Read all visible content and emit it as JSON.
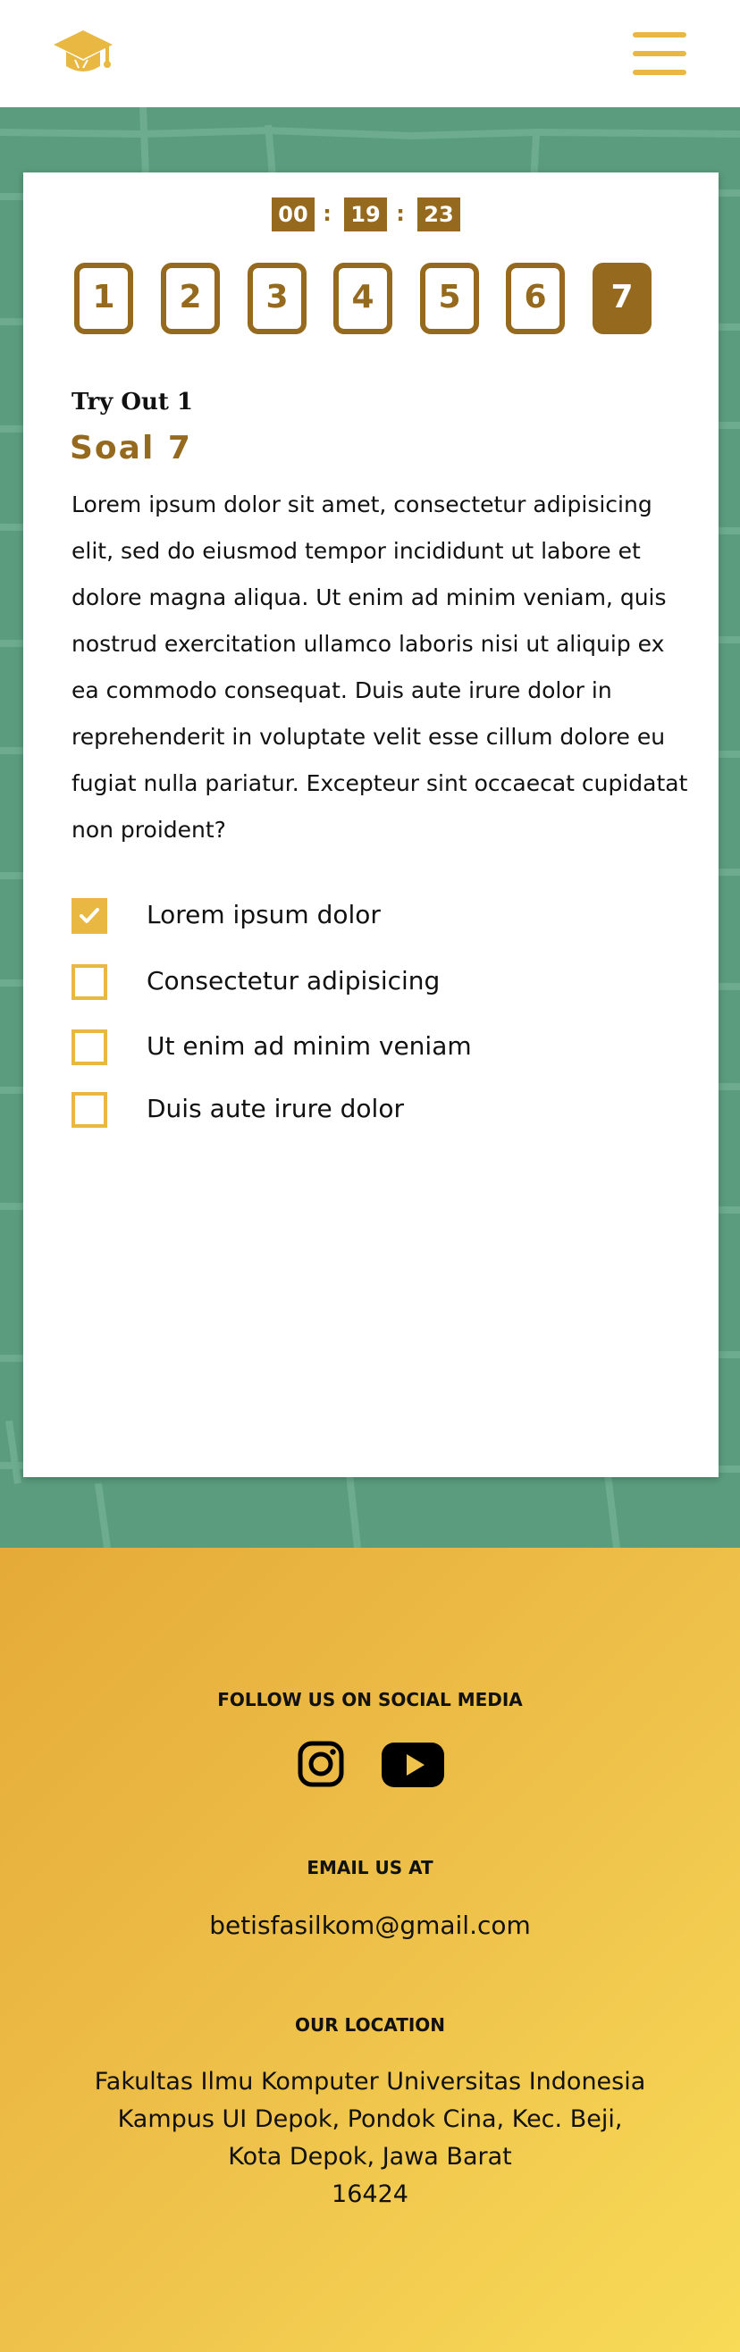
{
  "header": {
    "logo_icon": "graduation-cap-icon",
    "menu_icon": "hamburger-menu-icon",
    "accent_color": "#E8B843"
  },
  "timer": {
    "hours": "00",
    "minutes": "19",
    "seconds": "23",
    "separator": ":"
  },
  "question_nav": [
    {
      "label": "1",
      "active": false
    },
    {
      "label": "2",
      "active": false
    },
    {
      "label": "3",
      "active": false
    },
    {
      "label": "4",
      "active": false
    },
    {
      "label": "5",
      "active": false
    },
    {
      "label": "6",
      "active": false
    },
    {
      "label": "7",
      "active": true
    }
  ],
  "quiz": {
    "tryout_label": "Try Out 1",
    "question_title": "Soal 7",
    "question_text": "Lorem ipsum dolor sit amet, consectetur adipisicing elit, sed do eiusmod  tempor incididunt ut labore et dolore magna aliqua. Ut enim ad minim veniam, quis nostrud exercitation ullamco laboris nisi ut aliquip ex ea commodo consequat. Duis aute irure dolor in reprehenderit in voluptate velit esse cillum dolore eu fugiat nulla pariatur. Excepteur sint occaecat cupidatat non proident?",
    "options": [
      {
        "label": "Lorem ipsum dolor",
        "checked": true
      },
      {
        "label": "Consectetur adipisicing",
        "checked": false
      },
      {
        "label": "Ut enim ad minim veniam",
        "checked": false
      },
      {
        "label": "Duis aute irure dolor",
        "checked": false
      }
    ]
  },
  "footer": {
    "social_heading": "FOLLOW US ON SOCIAL MEDIA",
    "social_icons": [
      "instagram-icon",
      "youtube-icon"
    ],
    "email_heading": "EMAIL US AT",
    "email": "betisfasilkom@gmail.com",
    "location_heading": "OUR LOCATION",
    "location_lines": [
      "Fakultas Ilmu Komputer Universitas Indonesia",
      "Kampus UI Depok, Pondok Cina, Kec. Beji,",
      "Kota Depok, Jawa Barat",
      "16424"
    ]
  },
  "colors": {
    "brown": "#966A1E",
    "gold": "#E8B843",
    "green_bg": "#5B9C7E"
  }
}
